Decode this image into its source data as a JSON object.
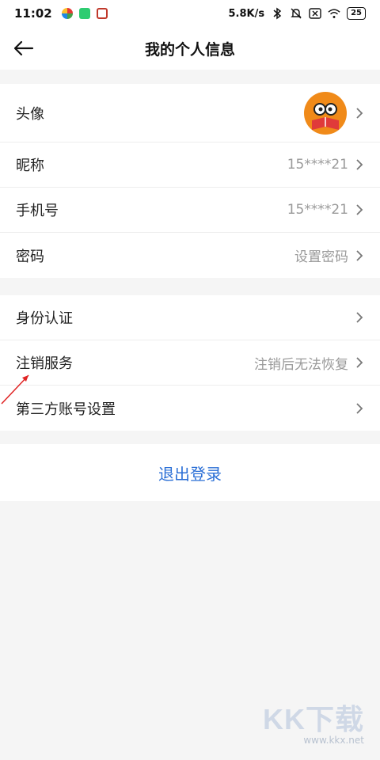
{
  "status_bar": {
    "time": "11:02",
    "network_speed": "5.8K/s",
    "battery": "25",
    "icons": [
      "app-icon-1",
      "app-icon-2",
      "app-icon-3",
      "bluetooth-icon",
      "mute-icon",
      "sim-off-icon",
      "wifi-icon",
      "battery-icon"
    ]
  },
  "header": {
    "title": "我的个人信息",
    "back_icon": "back-arrow-icon"
  },
  "profile_section": {
    "items": [
      {
        "label": "头像",
        "value": ""
      },
      {
        "label": "昵称",
        "value": "15****21"
      },
      {
        "label": "手机号",
        "value": "15****21"
      },
      {
        "label": "密码",
        "value": "设置密码"
      }
    ]
  },
  "account_section": {
    "items": [
      {
        "label": "身份认证",
        "value": ""
      },
      {
        "label": "注销服务",
        "value": "注销后无法恢复"
      },
      {
        "label": "第三方账号设置",
        "value": ""
      }
    ]
  },
  "logout": {
    "label": "退出登录"
  },
  "watermark": {
    "logo": "KK下载",
    "url": "www.kkx.net"
  },
  "colors": {
    "accent": "#2b6fd6",
    "avatar": "#f08a19",
    "background": "#f5f5f5",
    "value_text": "#999999"
  }
}
